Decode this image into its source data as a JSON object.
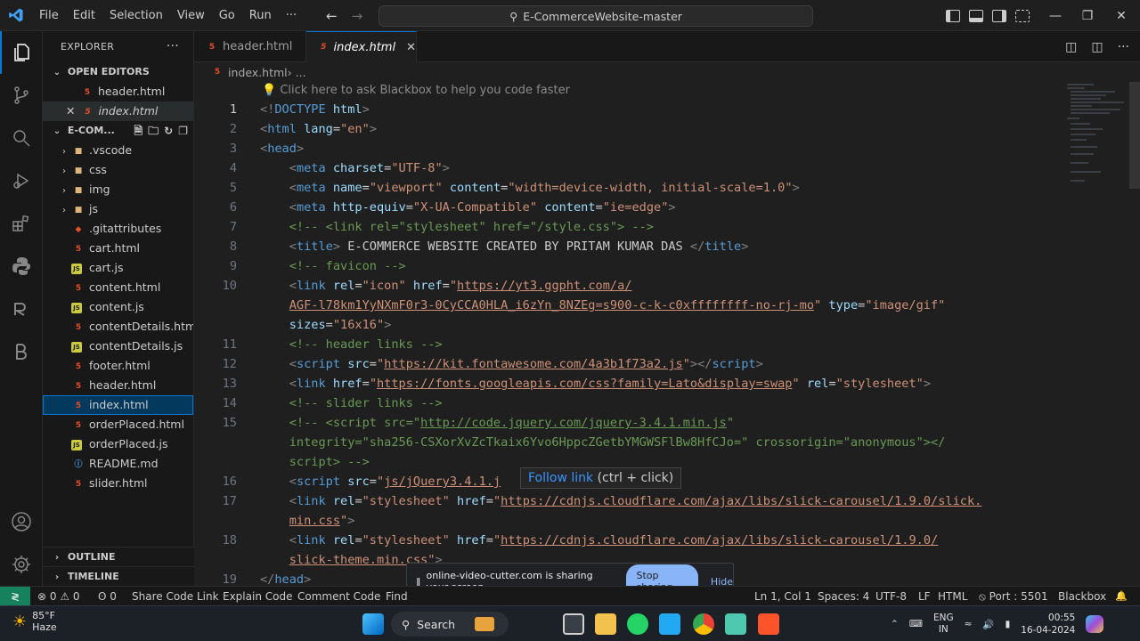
{
  "titlebar": {
    "menu": [
      "File",
      "Edit",
      "Selection",
      "View",
      "Go",
      "Run",
      "···"
    ],
    "search_text": "E-CommerceWebsite-master",
    "minimize": "—",
    "maximize": "❐",
    "close": "✕"
  },
  "explorer": {
    "title": "EXPLORER",
    "more": "···",
    "open_editors_label": "OPEN EDITORS",
    "open_editors": [
      {
        "name": "header.html",
        "icon": "html-file-icon"
      },
      {
        "name": "index.html",
        "icon": "html-file-icon"
      }
    ],
    "project_label": "E-COM...",
    "tree": [
      {
        "name": ".vscode",
        "type": "folder"
      },
      {
        "name": "css",
        "type": "folder"
      },
      {
        "name": "img",
        "type": "folder"
      },
      {
        "name": "js",
        "type": "folder"
      },
      {
        "name": ".gitattributes",
        "type": "git"
      },
      {
        "name": "cart.html",
        "type": "html"
      },
      {
        "name": "cart.js",
        "type": "js"
      },
      {
        "name": "content.html",
        "type": "html"
      },
      {
        "name": "content.js",
        "type": "js"
      },
      {
        "name": "contentDetails.html",
        "type": "html"
      },
      {
        "name": "contentDetails.js",
        "type": "js"
      },
      {
        "name": "footer.html",
        "type": "html"
      },
      {
        "name": "header.html",
        "type": "html"
      },
      {
        "name": "index.html",
        "type": "html"
      },
      {
        "name": "orderPlaced.html",
        "type": "html"
      },
      {
        "name": "orderPlaced.js",
        "type": "js"
      },
      {
        "name": "README.md",
        "type": "md"
      },
      {
        "name": "slider.html",
        "type": "html"
      }
    ],
    "outline_label": "OUTLINE",
    "timeline_label": "TIMELINE"
  },
  "tabs": [
    {
      "name": "header.html"
    },
    {
      "name": "index.html",
      "close": "✕"
    }
  ],
  "breadcrumb": {
    "file": "index.html",
    "rest": " › ..."
  },
  "editor": {
    "hint": "💡 Click here to ask Blackbox to help you code faster",
    "line_numbers": [
      "1",
      "2",
      "3",
      "4",
      "5",
      "6",
      "7",
      "8",
      "9",
      "10",
      "",
      "",
      "11",
      "12",
      "13",
      "14",
      "15",
      "",
      "",
      "16",
      "17",
      "",
      "18",
      "",
      "19"
    ]
  },
  "tooltip": {
    "link": "Follow link",
    "hint": " (ctrl + click)"
  },
  "sharebar": {
    "pause_icon": "‖",
    "message": "online-video-cutter.com is sharing your screen.",
    "stop_label": "Stop sharing",
    "hide_label": "Hide"
  },
  "statusbar": {
    "remote": "≷",
    "problems": "⊗ 0 ⚠ 0",
    "ports": "ʘ 0",
    "share_code": "Share Code Link",
    "explain": "Explain Code",
    "comment": "Comment Code",
    "find": "Find",
    "position": "Ln 1, Col 1",
    "spaces": "Spaces: 4",
    "encoding": "UTF-8",
    "eol": "LF",
    "language": "HTML",
    "port": "⦸ Port : 5501",
    "blackbox": "Blackbox",
    "bell": "🔔"
  },
  "taskbar": {
    "temp": "85°F",
    "weather": "Haze",
    "search": "Search",
    "lang_top": "ENG",
    "lang_bottom": "IN",
    "time": "00:55",
    "date": "16-04-2024"
  }
}
